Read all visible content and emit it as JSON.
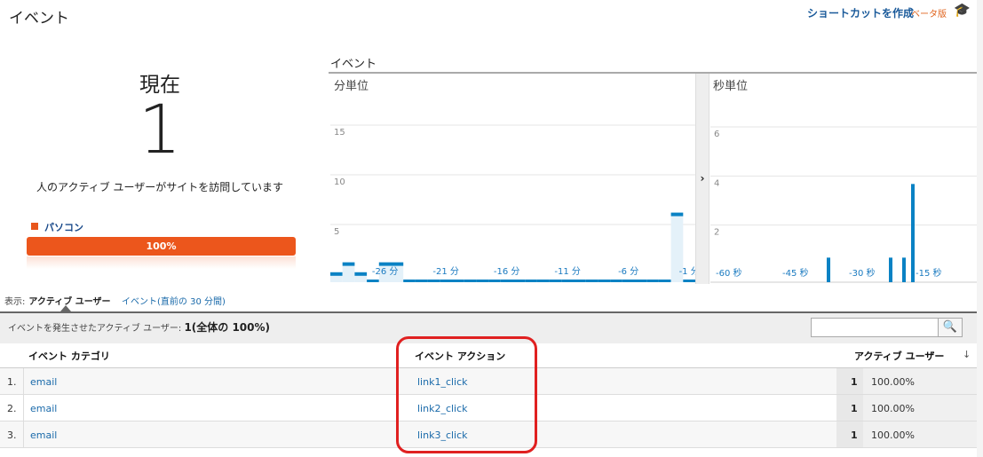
{
  "header": {
    "title": "イベント",
    "shortcut_label": "ショートカットを作成",
    "beta_label": "ベータ版",
    "cap_icon": "graduation-cap-icon"
  },
  "now": {
    "label": "現在",
    "count": "1",
    "description": "人のアクティブ ユーザーがサイトを訪問しています",
    "device_label": "パソコン",
    "device_percent": 100,
    "device_percent_label": "100%",
    "device_color": "#ec561c"
  },
  "chart": {
    "title": "イベント",
    "minute_label": "分単位",
    "second_label": "秒単位",
    "expand_icon": "chevron-right-icon"
  },
  "chart_data": [
    {
      "type": "bar",
      "title": "分単位",
      "ylim": [
        0,
        17
      ],
      "yticks": [
        5,
        10,
        15
      ],
      "x_labels": [
        {
          "x": -26,
          "label": "-26 分"
        },
        {
          "x": -21,
          "label": "-21 分"
        },
        {
          "x": -16,
          "label": "-16 分"
        },
        {
          "x": -11,
          "label": "-11 分"
        },
        {
          "x": -6,
          "label": "-6 分"
        },
        {
          "x": -1,
          "label": "-1 分"
        }
      ],
      "x": [
        -30,
        -29,
        -28,
        -27,
        -26,
        -25,
        -24,
        -23,
        -22,
        -21,
        -20,
        -19,
        -18,
        -17,
        -16,
        -15,
        -14,
        -13,
        -12,
        -11,
        -10,
        -9,
        -8,
        -7,
        -6,
        -5,
        -4,
        -3,
        -2,
        -1
      ],
      "values": [
        1,
        2,
        1,
        0,
        2,
        2,
        0,
        0,
        0,
        0,
        0,
        0,
        0,
        0,
        0,
        0,
        0,
        0,
        0,
        0,
        0,
        0,
        0,
        0,
        0,
        0,
        0,
        0,
        7,
        0
      ],
      "color": "#0a82c4"
    },
    {
      "type": "bar",
      "title": "秒単位",
      "ylim": [
        0,
        7
      ],
      "yticks": [
        2,
        4,
        6
      ],
      "x_labels": [
        {
          "x": -60,
          "label": "-60 秒"
        },
        {
          "x": -45,
          "label": "-45 秒"
        },
        {
          "x": -30,
          "label": "-30 秒"
        },
        {
          "x": -15,
          "label": "-15 秒"
        }
      ],
      "points": [
        {
          "x": -35,
          "y": 1
        },
        {
          "x": -21,
          "y": 1
        },
        {
          "x": -18,
          "y": 1
        },
        {
          "x": -16,
          "y": 4
        }
      ],
      "color": "#0a82c4"
    }
  ],
  "view": {
    "prefix": "表示:",
    "active": "アクティブ ユーザー",
    "alt": "イベント(直前の 30 分間)"
  },
  "summary": {
    "label": "イベントを発生させたアクティブ ユーザー:",
    "value": "1(全体の 100%)"
  },
  "search": {
    "placeholder": "",
    "icon": "search-icon"
  },
  "table": {
    "headers": [
      "イベント カテゴリ",
      "イベント アクション",
      "アクティブ ユーザー"
    ],
    "rows": [
      {
        "idx": "1.",
        "category": "email",
        "action": "link1_click",
        "count": "1",
        "pct": "100.00%"
      },
      {
        "idx": "2.",
        "category": "email",
        "action": "link2_click",
        "count": "1",
        "pct": "100.00%"
      },
      {
        "idx": "3.",
        "category": "email",
        "action": "link3_click",
        "count": "1",
        "pct": "100.00%"
      }
    ]
  }
}
